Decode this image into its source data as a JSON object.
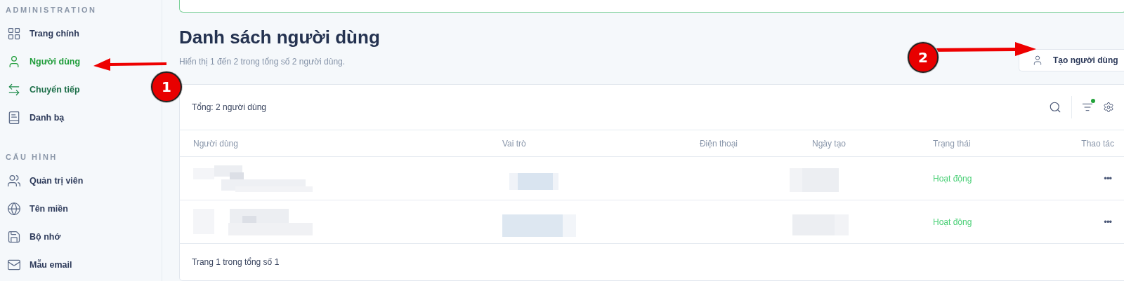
{
  "sidebar": {
    "sections": [
      {
        "title": "ADMINISTRATION",
        "items": [
          {
            "label": "Trang chính",
            "selected": false,
            "hovered": false
          },
          {
            "label": "Người dùng",
            "selected": true,
            "hovered": false
          },
          {
            "label": "Chuyển tiếp",
            "selected": false,
            "hovered": true
          },
          {
            "label": "Danh bạ",
            "selected": false,
            "hovered": false
          }
        ]
      },
      {
        "title": "CẤU HÌNH",
        "items": [
          {
            "label": "Quản trị viên",
            "selected": false,
            "hovered": false
          },
          {
            "label": "Tên miền",
            "selected": false,
            "hovered": false
          },
          {
            "label": "Bộ nhớ",
            "selected": false,
            "hovered": false
          },
          {
            "label": "Mẫu email",
            "selected": false,
            "hovered": false
          }
        ]
      }
    ]
  },
  "page": {
    "title": "Danh sách người dùng",
    "subtitle": "Hiển thị 1 đến 2 trong tổng số 2 người dùng.",
    "create_button": "Tạo người dùng"
  },
  "table": {
    "total": "Tổng: 2 người dùng",
    "filter_active": true,
    "columns": [
      "Người dùng",
      "Vai trò",
      "Điện thoại",
      "Ngày tạo",
      "Trạng thái",
      "Thao tác"
    ],
    "rows": [
      {
        "status": "Hoạt động",
        "actions": "•••"
      },
      {
        "status": "Hoạt động",
        "actions": "•••"
      }
    ],
    "footer": "Trang 1 trong tổng số 1"
  },
  "annotations": [
    {
      "number": "1"
    },
    {
      "number": "2"
    }
  ]
}
